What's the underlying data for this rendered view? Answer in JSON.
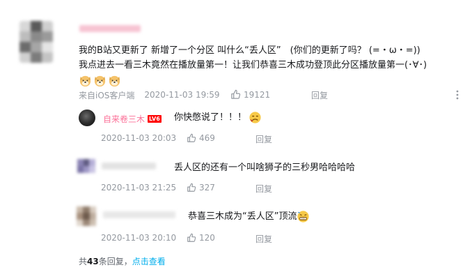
{
  "top_comment": {
    "line1": "我的B站又更新了 新增了一个分区 叫什么“丢人区”　(你们的更新了吗？ (=・ω・=))",
    "line2": "我点进去一看三木竟然在播放量第一！让我们恭喜三木成功登顶此分区播放量第一(･∀･)",
    "emoji_count_label": "",
    "meta": "来自iOS客户端",
    "time": "2020-11-03 19:59",
    "likes": "19121",
    "reply": "回复"
  },
  "replies": [
    {
      "username": "自来卷三木",
      "level": "LV6",
      "text": "你快憋说了！！！",
      "time": "2020-11-03 20:03",
      "likes": "469",
      "reply": "回复"
    },
    {
      "text": "丢人区的还有一个叫啥狮子的三秒男哈哈哈哈",
      "time": "2020-11-03 21:25",
      "likes": "327",
      "reply": "回复"
    },
    {
      "text": "恭喜三木成为“丢人区”顶流",
      "time": "2020-11-03 20:10",
      "likes": "120",
      "reply": "回复"
    }
  ],
  "footer": {
    "prefix": "共",
    "count": "43",
    "suffix": "条回复，",
    "link": "点击查看"
  },
  "colors": {
    "accent_link": "#00aeec",
    "username_red": "#fb7299",
    "meta_grey": "#9499a0"
  },
  "icons": [
    "thumbs-up-icon",
    "more-icon",
    "doge-emoji-icon",
    "speechless-emoji-icon",
    "grimace-emoji-icon"
  ]
}
